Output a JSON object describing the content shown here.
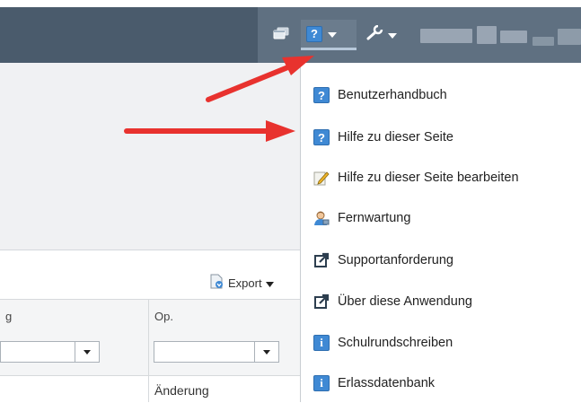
{
  "toolbar": {
    "icons": [
      "windows-icon",
      "help-icon",
      "wrench-icon"
    ],
    "colors": {
      "bar": "#4a5b6c",
      "bar_right": "#5f7081"
    }
  },
  "help_menu": {
    "items": [
      {
        "label": "Benutzerhandbuch",
        "icon": "help-icon"
      },
      {
        "label": "Hilfe zu dieser Seite",
        "icon": "help-icon"
      },
      {
        "label": "Hilfe zu dieser Seite bearbeiten",
        "icon": "edit-note-icon"
      },
      {
        "label": "Fernwartung",
        "icon": "support-person-icon"
      },
      {
        "label": "Supportanforderung",
        "icon": "external-link-icon"
      },
      {
        "label": "Über diese Anwendung",
        "icon": "external-link-icon"
      },
      {
        "label": "Schulrundschreiben",
        "icon": "info-icon"
      },
      {
        "label": "Erlassdatenbank",
        "icon": "info-icon"
      }
    ]
  },
  "grid": {
    "export_label": "Export",
    "columns": [
      {
        "header": "g"
      },
      {
        "header": "Op."
      }
    ],
    "first_row": {
      "op": "Änderung"
    }
  },
  "annotations": {
    "arrow_color": "#e8322e"
  }
}
